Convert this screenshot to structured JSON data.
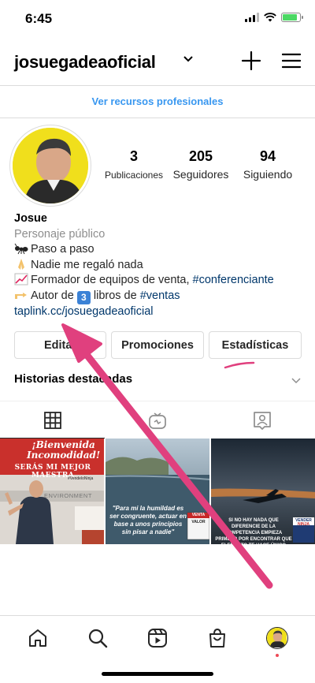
{
  "status_bar": {
    "time": "6:45"
  },
  "header": {
    "username": "josuegadeaoficial"
  },
  "pro_banner": "Ver recursos profesionales",
  "stats": [
    {
      "num": "3",
      "label": "Publicaciones"
    },
    {
      "num": "205",
      "label": "Seguidores"
    },
    {
      "num": "94",
      "label": "Siguiendo"
    }
  ],
  "bio": {
    "name": "Josue",
    "category": "Personaje público",
    "line1": "Paso a paso",
    "line2": "Nadie me regaló nada",
    "line3_text": "Formador de equipos de venta, ",
    "line3_tag": "#conferenciante",
    "line4_pre": "Autor de ",
    "line4_num": "3",
    "line4_mid": " libros de ",
    "line4_tag": "#ventas",
    "link": "taplink.cc/josuegadeaoficial"
  },
  "buttons": {
    "edit": "Editar",
    "promotions": "Promociones",
    "stats": "Estadísticas"
  },
  "highlights_label": "Historias destacadas",
  "posts": [
    {
      "line1": "¡Bienvenida",
      "line2": "Incomodidad!",
      "line3": "SERÁS MI MEJOR MAESTRA",
      "hashtag": "#VendeloNinja",
      "bg_word": "ENVIRONMENT"
    },
    {
      "caption": "\"Para mi la humildad es ser congruente, actuar en base a unos principios sin pisar a nadie\"",
      "badge_top": "VENTA",
      "badge_bottom": "VALOR"
    },
    {
      "caption": "SI NO HAY NADA QUE DIFERENCIE DE LA COMPETENCIA EMPIEZA PRIMERO POR ENCONTRAR QUE ELEMENTO TE HACE ÚNICO",
      "book_top": "VENDER",
      "book_bottom": "NINJA"
    }
  ],
  "colors": {
    "accent": "#3897f0",
    "annotation": "#e0407e",
    "link": "#00376b"
  }
}
